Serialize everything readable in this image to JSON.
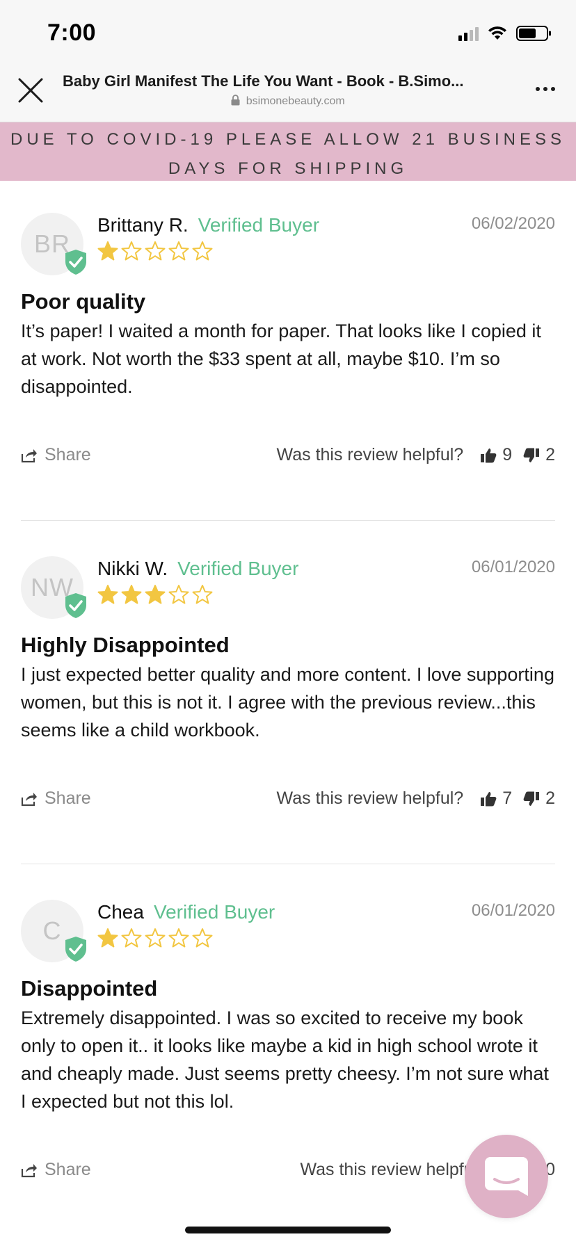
{
  "status_bar": {
    "time": "7:00"
  },
  "browser": {
    "title": "Baby Girl Manifest The Life You Want - Book - B.Simo...",
    "url": "bsimonebeauty.com"
  },
  "banner": {
    "line1": "DUE TO COVID-19 PLEASE ALLOW 21 BUSINESS",
    "line2": "DAYS FOR SHIPPING",
    "background": "#e2b8cb"
  },
  "colors": {
    "verified_green": "#5fbf8f",
    "star_gold": "#f2c641",
    "chat_pink": "#dfb1c6"
  },
  "reviews": [
    {
      "initials": "BR",
      "name": "Brittany R.",
      "verified_label": "Verified Buyer",
      "date": "06/02/2020",
      "rating": 1,
      "title": "Poor quality",
      "body": "It’s paper! I waited a month for paper. That looks like I copied it at work. Not worth the $33 spent at all, maybe $10. I’m so disappointed.",
      "share_label": "Share",
      "helpful_label": "Was this review helpful?",
      "upvotes": "9",
      "downvotes": "2"
    },
    {
      "initials": "NW",
      "name": "Nikki W.",
      "verified_label": "Verified Buyer",
      "date": "06/01/2020",
      "rating": 3,
      "title": "Highly Disappointed",
      "body": "I just expected better quality and more content. I love supporting women, but this is not it. I agree with the previous review...this seems like a child workbook.",
      "share_label": "Share",
      "helpful_label": "Was this review helpful?",
      "upvotes": "7",
      "downvotes": "2"
    },
    {
      "initials": "C",
      "name": "Chea",
      "verified_label": "Verified Buyer",
      "date": "06/01/2020",
      "rating": 1,
      "title": "Disappointed",
      "body": "Extremely disappointed. I was so excited to receive my book only to open it.. it looks like maybe a kid in high school wrote it and cheaply made. Just seems pretty cheesy. I’m not sure what I expected but not this lol.",
      "share_label": "Share",
      "helpful_label": "Was this review helpful?",
      "partial_vote_text": "0"
    }
  ]
}
